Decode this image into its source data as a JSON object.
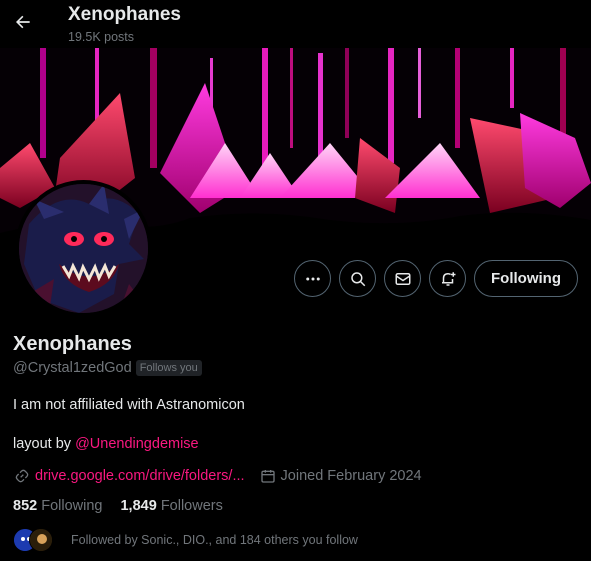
{
  "header": {
    "title": "Xenophanes",
    "posts_count": "19.5K posts",
    "back_icon": "arrow-left-icon"
  },
  "actions": {
    "more_icon": "more-icon",
    "search_icon": "search-icon",
    "message_icon": "mail-icon",
    "notify_icon": "bell-plus-icon",
    "following_label": "Following"
  },
  "profile": {
    "name": "Xenophanes",
    "handle": "@Crystal1zedGod",
    "follows_you": "Follows you",
    "bio_line1": "I am not affiliated with Astranomicon",
    "bio_line2_prefix": "layout by ",
    "bio_mention": "@Unendingdemise",
    "link": "drive.google.com/drive/folders/...",
    "joined": "Joined February 2024"
  },
  "stats": {
    "following_count": "852",
    "following_label": "Following",
    "followers_count": "1,849",
    "followers_label": "Followers"
  },
  "followed_by": "Followed by Sonic., DIO., and 184 others you follow",
  "colors": {
    "accent": "#f91880",
    "muted": "#71767b",
    "text": "#e7e9ea",
    "border": "#536471",
    "banner_magenta": "#ff1fd0",
    "banner_red": "#e0134a"
  }
}
